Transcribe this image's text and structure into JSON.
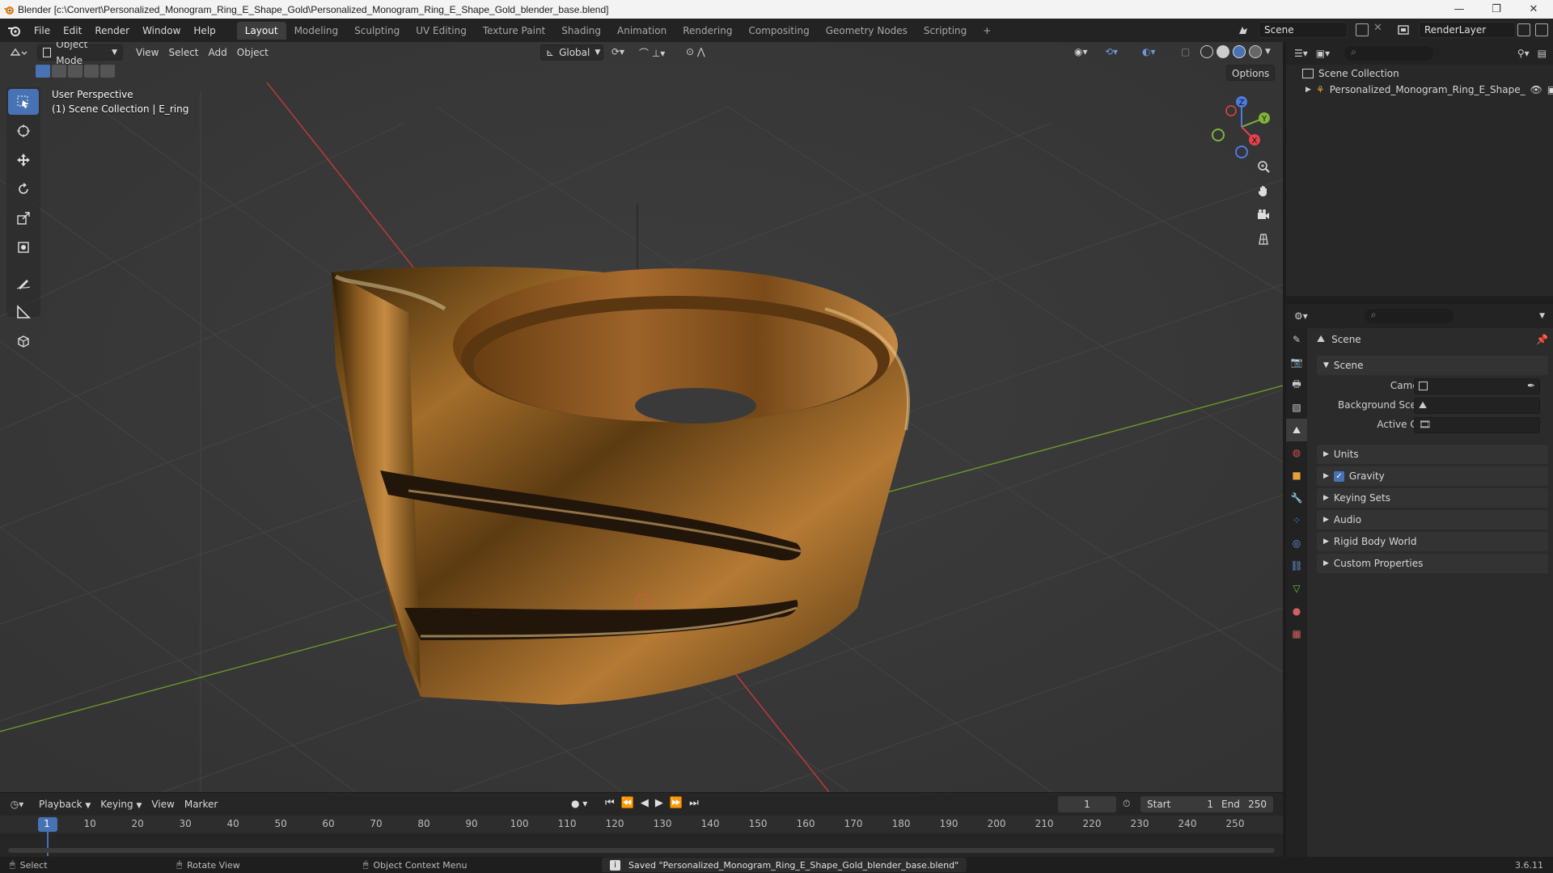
{
  "window": {
    "title": "Blender [c:\\Convert\\Personalized_Monogram_Ring_E_Shape_Gold\\Personalized_Monogram_Ring_E_Shape_Gold_blender_base.blend]"
  },
  "menus": [
    "File",
    "Edit",
    "Render",
    "Window",
    "Help"
  ],
  "workspaces": {
    "tabs": [
      "Layout",
      "Modeling",
      "Sculpting",
      "UV Editing",
      "Texture Paint",
      "Shading",
      "Animation",
      "Rendering",
      "Compositing",
      "Geometry Nodes",
      "Scripting"
    ],
    "active": "Layout",
    "add_symbol": "+"
  },
  "scene_selector": {
    "label": "Scene"
  },
  "view_layer_selector": {
    "label": "RenderLayer"
  },
  "viewport": {
    "mode": "Object Mode",
    "menus": [
      "View",
      "Select",
      "Add",
      "Object"
    ],
    "orientation": "Global",
    "options_label": "Options",
    "perspective_label": "User Perspective",
    "collection_label": "(1) Scene Collection | E_ring",
    "gizmo_axes": {
      "z": "Z",
      "y": "Y",
      "x": "X"
    },
    "colors": {
      "background": "#393939",
      "x_axis": "#c8393f",
      "y_axis": "#6b9a2a",
      "active_tool": "#4772b3"
    }
  },
  "toolbar": {
    "tools": [
      "select-box-tool",
      "cursor-tool",
      "move-tool",
      "rotate-tool",
      "scale-tool",
      "transform-tool",
      "annotate-tool",
      "measure-tool",
      "add-cube-tool"
    ],
    "active": "select-box-tool"
  },
  "outliner": {
    "root": "Scene Collection",
    "items": [
      {
        "name": "Personalized_Monogram_Ring_E_Shape_"
      }
    ]
  },
  "properties": {
    "context": "Scene",
    "sections": {
      "scene": {
        "title": "Scene",
        "fields": [
          {
            "label": "Camera",
            "value": ""
          },
          {
            "label": "Background Scene",
            "value": ""
          },
          {
            "label": "Active Clip",
            "value": ""
          }
        ]
      },
      "collapsed": [
        "Units",
        "Gravity",
        "Keying Sets",
        "Audio",
        "Rigid Body World",
        "Custom Properties"
      ],
      "gravity_checked": true
    }
  },
  "timeline": {
    "menus": [
      "Playback",
      "Keying",
      "View",
      "Marker"
    ],
    "current_frame": "1",
    "start_label": "Start",
    "start": "1",
    "end_label": "End",
    "end": "250",
    "ruler_ticks": [
      "1",
      "10",
      "20",
      "30",
      "40",
      "50",
      "60",
      "70",
      "80",
      "90",
      "100",
      "110",
      "120",
      "130",
      "140",
      "150",
      "160",
      "170",
      "180",
      "190",
      "200",
      "210",
      "220",
      "230",
      "240",
      "250"
    ]
  },
  "statusbar": {
    "hints": [
      "Select",
      "Rotate View",
      "Object Context Menu"
    ],
    "message": "Saved \"Personalized_Monogram_Ring_E_Shape_Gold_blender_base.blend\"",
    "version": "3.6.11"
  }
}
